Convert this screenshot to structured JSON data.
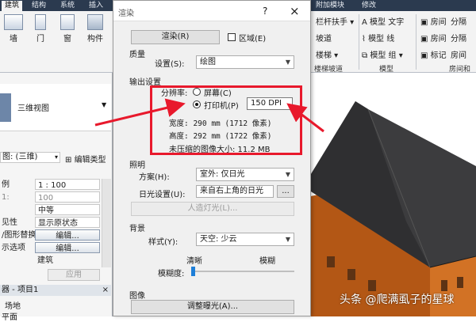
{
  "ribbon": {
    "tabs": [
      "建筑",
      "结构",
      "系统",
      "插入"
    ],
    "right_tabs": [
      "附加模块",
      "修改"
    ],
    "left_buttons": [
      "墙",
      "门",
      "窗",
      "构件"
    ],
    "right_items": [
      "栏杆扶手",
      "模型 文字",
      "房间",
      "分隔",
      "坡道",
      "模型 线",
      "房间",
      "分隔",
      "楼梯",
      "模型 组",
      "标记",
      "房间"
    ],
    "groups": [
      "楼梯坡道",
      "模型",
      "房间和"
    ]
  },
  "properties": {
    "type_name": "三维视图",
    "view_selector": "图: (三维)",
    "edit_type": "编辑类型",
    "rows": [
      {
        "label": "例",
        "value": "1 : 100"
      },
      {
        "label": "1:",
        "value": "100"
      },
      {
        "label": "",
        "value": "中等"
      },
      {
        "label": "见性",
        "value": "显示原状态"
      },
      {
        "label": "/图形替换",
        "value": "编辑..."
      },
      {
        "label": "示选项",
        "value": "编辑..."
      },
      {
        "label": "",
        "value": "建筑"
      }
    ],
    "apply": "应用",
    "browser_title": "器 - 项目1",
    "browser_items": [
      "场地",
      "平面"
    ]
  },
  "dialog": {
    "title": "渲染",
    "help": "?",
    "close": "×",
    "render_button": "渲染(R)",
    "region_label": "区域(E)",
    "quality_header": "质量",
    "setting_label": "设置(S):",
    "setting_value": "绘图",
    "output_header": "输出设置",
    "resolution_label": "分辨率:",
    "screen_label": "屏幕(C)",
    "printer_label": "打印机(P)",
    "dpi_value": "150 DPI",
    "width_text": "宽度:  290 mm (1712 像素)",
    "height_text": "高度:  292 mm (1722 像素)",
    "size_text": "未压缩的图像大小: 11.2 MB",
    "lighting_header": "照明",
    "scheme_label": "方案(H):",
    "scheme_value": "室外: 仅日光",
    "sun_label": "日光设置(U):",
    "sun_value": "来自右上角的日光",
    "ellipsis": "...",
    "artificial_button": "人造灯光(L)...",
    "background_header": "背景",
    "style_label": "样式(Y):",
    "style_value": "天空: 少云",
    "clear_label": "清晰",
    "blur_label": "模糊",
    "haze_label": "模糊度:",
    "image_header": "图像",
    "exposure_button": "调整曝光(A)..."
  },
  "watermark": "头条 @爬满虱子的星球",
  "colors": {
    "annotation_red": "#e8192c",
    "roof_dark": "#3c3c3e",
    "wall_orange": "#c4641c"
  }
}
